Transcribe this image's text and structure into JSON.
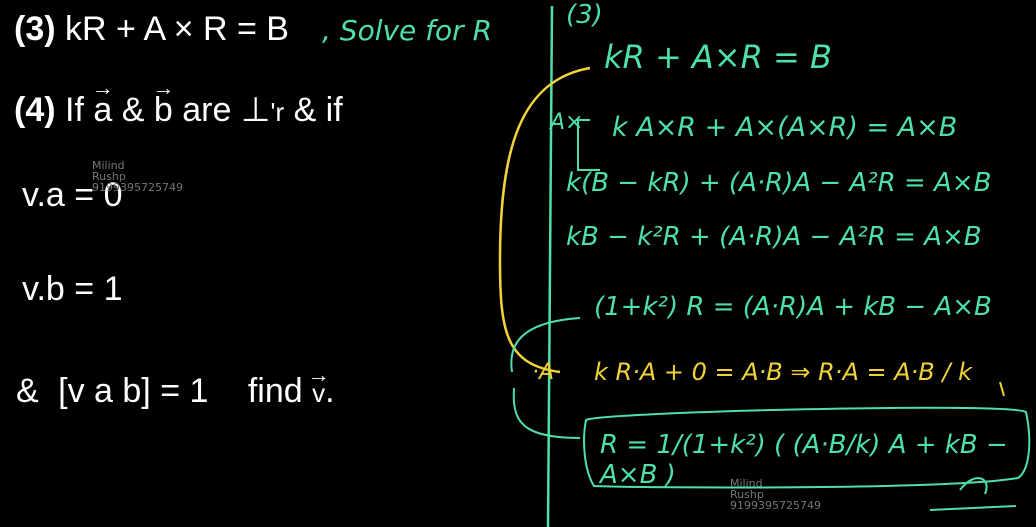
{
  "left": {
    "q3": {
      "num": "(3)",
      "expr": "kR + A × R = B",
      "note": ", Solve for R"
    },
    "q4": {
      "num": "(4)",
      "if": "If",
      "a": "a",
      "amp": "&",
      "b": "b",
      "are": "are",
      "perp": "⊥",
      "r": "'r",
      "and_if": "& if"
    },
    "eq1": "v.a = 0",
    "eq2": "v.b = 1",
    "eq3": {
      "amp": "&",
      "bracket": "[v a b] = 1",
      "find": "find",
      "v": "v",
      "dot": "."
    }
  },
  "solution": {
    "num": "(3)",
    "l1": "kR + A×R = B",
    "l2_side": "A×",
    "l2": "k A×R + A×(A×R) = A×B",
    "l3": "k(B − kR) + (A·R)A − A²R = A×B",
    "l4": "kB − k²R + (A·R)A − A²R = A×B",
    "l5": "(1+k²) R = (A·R)A + kB − A×B",
    "l6_side": "·A",
    "l6": "k R·A + 0 = A·B ⇒ R·A = A·B / k",
    "l7": "R = 1/(1+k²) ( (A·B/k) A + kB − A×B )"
  },
  "watermarks": [
    {
      "name": "Milind",
      "line2": "Rushp",
      "line3": "9199395725749"
    },
    {
      "name": "Milind",
      "line2": "Rushp",
      "line3": "9199395725749"
    }
  ],
  "colors": {
    "ink": "#4ee0a8",
    "highlight": "#f2d23a",
    "background": "#000000",
    "text": "#ffffff"
  }
}
